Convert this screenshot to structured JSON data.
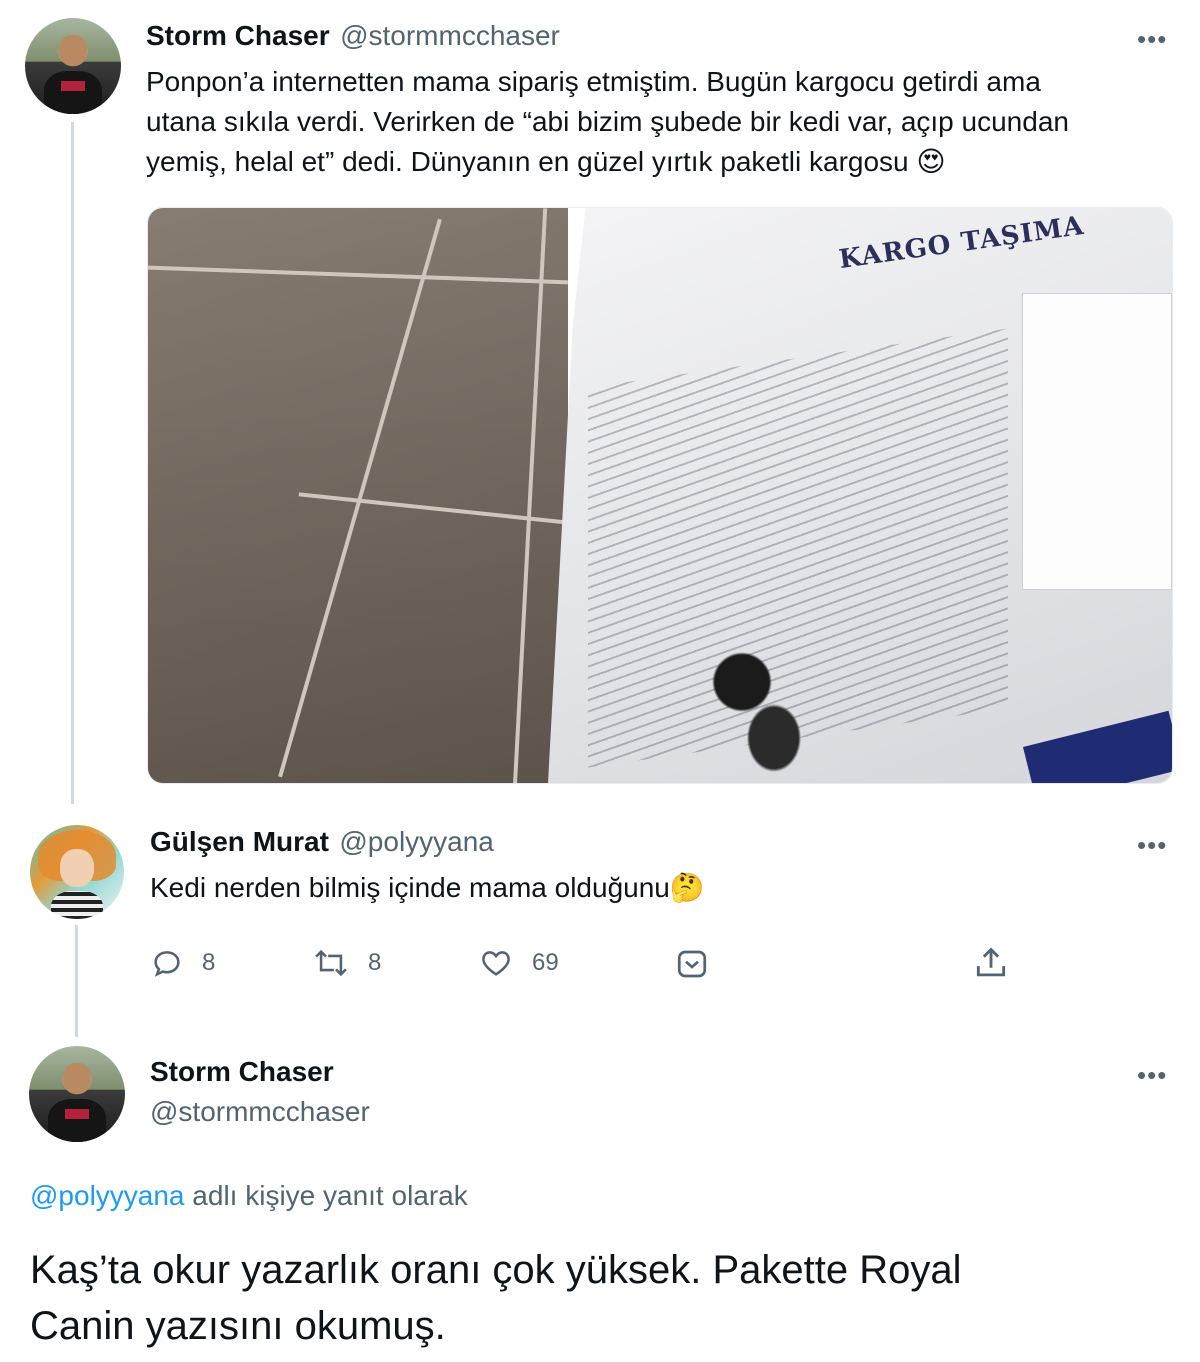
{
  "tweet1": {
    "name": "Storm Chaser",
    "handle": "@stormmcchaser",
    "text_line1": "Ponpon’a internetten mama sipariş etmiştim. Bugün kargocu getirdi ama",
    "text_line2": "utana sıkıla verdi. Verirken de “abi bizim şubede bir kedi var, açıp ucundan",
    "text_line3": "yemiş, helal et” dedi. Dünyanın en güzel yırtık paketli kargosu",
    "emoji": "😍",
    "more": "•••",
    "media_text": "KARGO TAŞIMA"
  },
  "tweet2": {
    "name": "Gülşen Murat",
    "handle": "@polyyyana",
    "text": "Kedi nerden bilmiş içinde mama olduğunu",
    "emoji": "🤔",
    "more": "•••",
    "actions": {
      "reply_count": "8",
      "retweet_count": "8",
      "like_count": "69"
    }
  },
  "tweet3": {
    "name": "Storm Chaser",
    "handle": "@stormmcchaser",
    "more": "•••",
    "reply_to_handle": "@polyyyana",
    "reply_to_suffix": " adlı kişiye yanıt olarak",
    "text_line1": "Kaş’ta okur yazarlık oranı çok yüksek. Pakette Royal",
    "text_line2": "Canin yazısını okumuş."
  },
  "icons": {
    "reply": "reply-icon",
    "retweet": "retweet-icon",
    "like": "heart-icon",
    "bookmark": "bookmark-icon",
    "share": "share-icon"
  },
  "colors": {
    "text": "#0f1419",
    "secondary": "#536471",
    "link": "#1d9bf0",
    "thread_line": "#cfd9de"
  }
}
